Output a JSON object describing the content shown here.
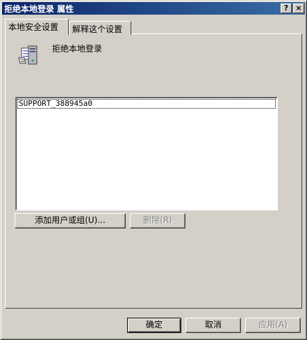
{
  "window": {
    "title": "拒绝本地登录 属性",
    "help_label": "?",
    "close_label": "×"
  },
  "tabs": [
    {
      "label": "本地安全设置",
      "active": true
    },
    {
      "label": "解释这个设置",
      "active": false
    }
  ],
  "policy": {
    "icon": "policy-server-icon",
    "title": "拒绝本地登录"
  },
  "list": {
    "items": [
      "SUPPORT_388945a0"
    ],
    "selected_index": 0
  },
  "buttons": {
    "add": "添加用户或组(U)...",
    "remove": "删除(R)",
    "ok": "确定",
    "cancel": "取消",
    "apply": "应用(A)"
  },
  "colors": {
    "dialog_face": "#d4d0c8",
    "title_bar_start": "#0a246a",
    "title_bar_end": "#3a6ea5",
    "disabled_text": "#808080"
  }
}
